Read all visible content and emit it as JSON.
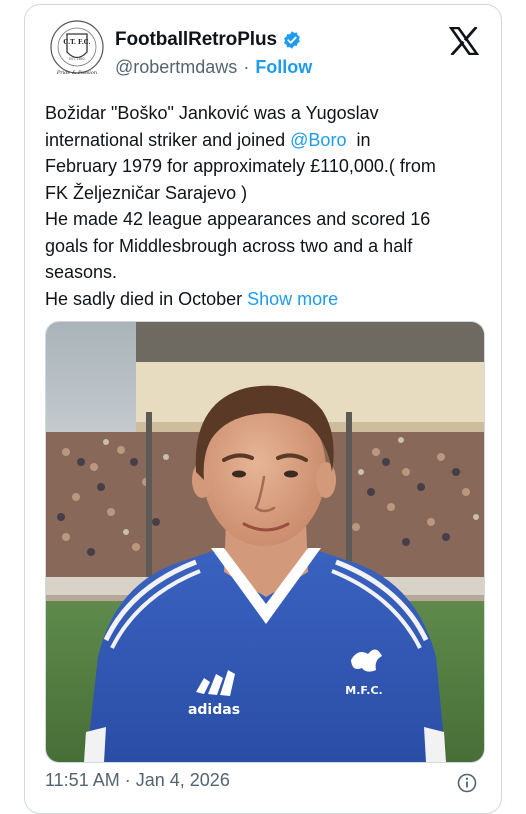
{
  "author": {
    "display_name": "FootballRetroPlus",
    "handle": "@robertmdaws",
    "separator": "·",
    "follow_label": "Follow",
    "avatar_icon": "club-crest-avatar",
    "avatar_text": {
      "ring": "CHELTENHAM TOWN F.C.",
      "initials": "C.T. F.C.",
      "est": "EST. 1892",
      "script": "Pride & Passion"
    },
    "verified_icon": "verified-badge-icon"
  },
  "platform": {
    "logo_icon": "x-logo-icon"
  },
  "tweet": {
    "line1": "Božidar \"Boško\" Janković was a Yugoslav",
    "line2_pre": "international striker and joined ",
    "mention": "@Boro",
    "line3": "February 1979 for approximately £110,000.( from",
    "line4": "FK Željezničar Sarajevo )",
    "line5": "He made 42 league appearances and scored 16",
    "line6": "goals for Middlesbrough across two and a half",
    "line7": "seasons.",
    "line8_pre": "He sadly died in October ",
    "show_more": "Show more"
  },
  "media": {
    "shirt_brand": "adidas",
    "shirt_badge": "M.F.C."
  },
  "meta": {
    "time": "11:51 AM",
    "separator": "·",
    "date": "Jan 4, 2026",
    "info_icon": "info-icon"
  },
  "colors": {
    "link_blue": "#1d9bf0",
    "secondary_text": "#536471",
    "verified_blue": "#1d9bf0",
    "shirt_blue": "#2f56b4"
  }
}
